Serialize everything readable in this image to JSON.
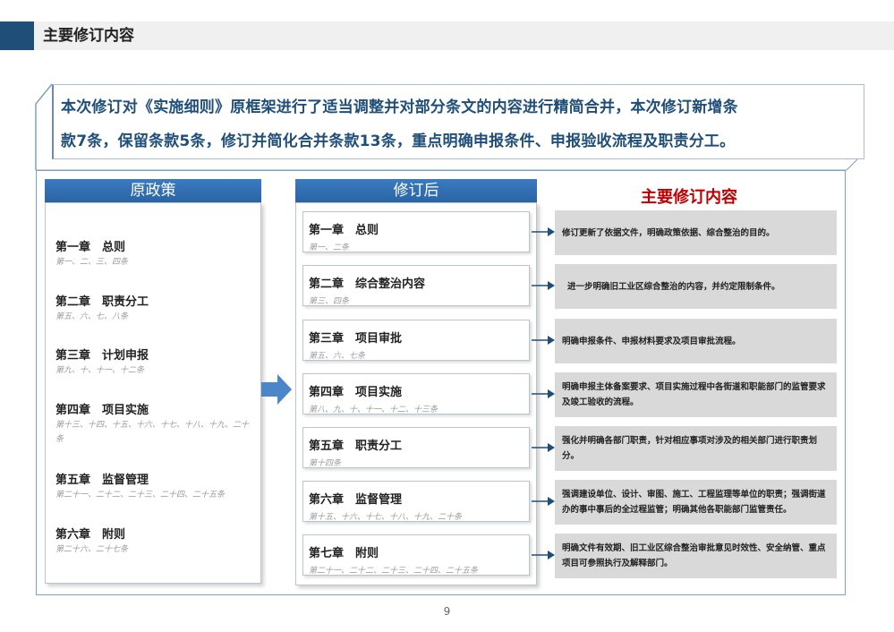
{
  "header": {
    "title": "主要修订内容"
  },
  "summary": {
    "line1": "本次修订对《实施细则》原框架进行了适当调整并对部分条文的内容进行精简合并，本次修订新增条",
    "line2": "款7条，保留条款5条，修订并简化合并条款13条，重点明确申报条件、申报验收流程及职责分工。"
  },
  "original": {
    "heading": "原政策",
    "chapters": [
      {
        "title": "第一章　总则",
        "articles": "第一、二、三、四条"
      },
      {
        "title": "第二章　职责分工",
        "articles": "第五、六、七、八条"
      },
      {
        "title": "第三章　计划申报",
        "articles": "第九、十、十一、十二条"
      },
      {
        "title": "第四章　项目实施",
        "articles": "第十三、十四、十五、十六、十七、十八、十九、二十条"
      },
      {
        "title": "第五章　监督管理",
        "articles": "第二十一、二十二、二十三、二十四、二十五条"
      },
      {
        "title": "第六章　附则",
        "articles": "第二十六、二十七条"
      }
    ]
  },
  "revised": {
    "heading": "修订后",
    "chapters": [
      {
        "title": "第一章　总则",
        "articles": "第一、二条"
      },
      {
        "title": "第二章　综合整治内容",
        "articles": "第三、四条"
      },
      {
        "title": "第三章　项目审批",
        "articles": "第五、六、七条"
      },
      {
        "title": "第四章　项目实施",
        "articles": "第八、九、十、十一、十二、十三条"
      },
      {
        "title": "第五章　职责分工",
        "articles": "第十四条"
      },
      {
        "title": "第六章　监督管理",
        "articles": "第十五、十六、十七、十八、十九、二十条"
      },
      {
        "title": "第七章　附则",
        "articles": "第二十一、二十二、二十三、二十四、二十五条"
      }
    ]
  },
  "revisions": {
    "heading": "主要修订内容",
    "items": [
      "修订更新了依据文件，明确政策依据、综合整治的目的。",
      "进一步明确旧工业区综合整治的内容，并约定限制条件。",
      "明确申报条件、申报材料要求及项目审批流程。",
      "明确申报主体备案要求、项目实施过程中各街道和职能部门的监管要求及竣工验收的流程。",
      "强化并明确各部门职责，针对相应事项对涉及的相关部门进行职责划分。",
      "强调建设单位、设计、审图、施工、工程监理等单位的职责；强调街道办的事中事后的全过程监管；明确其他各职能部门监管责任。",
      "明确文件有效期、旧工业区综合整治审批意见时效性、安全纳管、重点项目可参照执行及解释部门。"
    ]
  },
  "page_number": "9",
  "colors": {
    "accent": "#1f4e79",
    "header_blue": "#2a64a4",
    "title_red": "#c00000",
    "desc_bg": "#d9d9d9"
  }
}
